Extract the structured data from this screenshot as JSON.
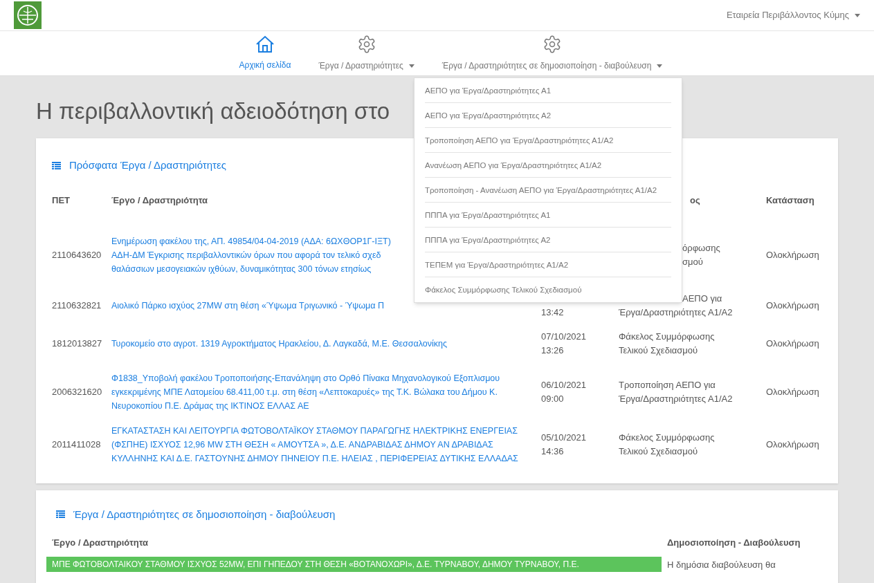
{
  "topbar": {
    "user_menu": "Εταιρεία Περιβάλλοντος Κύμης"
  },
  "nav": [
    {
      "label": "Αρχική σελίδα",
      "selected": true,
      "dropdown": false
    },
    {
      "label": "Έργα / Δραστηριότητες",
      "selected": false,
      "dropdown": true
    },
    {
      "label": "Έργα / Δραστηριότητες σε δημοσιοποίηση - διαβούλευση",
      "selected": false,
      "dropdown": true
    }
  ],
  "open_menu": [
    "ΑΕΠΟ για Έργα/Δραστηριότητες Α1",
    "ΑΕΠΟ για Έργα/Δραστηριότητες Α2",
    "Τροποποίηση ΑΕΠΟ για Έργα/Δραστηριότητες Α1/Α2",
    "Ανανέωση ΑΕΠΟ για Έργα/Δραστηριότητες Α1/Α2",
    "Τροποποίηση - Ανανέωση ΑΕΠΟ για Έργα/Δραστηριότητες Α1/Α2",
    "ΠΠΠΑ για Έργα/Δραστηριότητες Α1",
    "ΠΠΠΑ για Έργα/Δραστηριότητες Α2",
    "ΤΕΠΕΜ για Έργα/Δραστηριότητες Α1/Α2",
    "Φάκελος Συμμόρφωσης Τελικού Σχεδιασμού"
  ],
  "page_title": "Η περιβαλλοντική αδειοδότηση στο",
  "recent": {
    "title": "Πρόσφατα Έργα / Δραστηριότητες",
    "columns": [
      "ΠΕΤ",
      "Έργο / Δραστηριότητα",
      "ος",
      "Κατάσταση"
    ],
    "rows": [
      {
        "pet": "2110643620",
        "title": [
          "Ενημέρωση φακέλου της, ΑΠ. 49854/04-04-2019 (ΑΔΑ: 6ΩΧΘΟΡ1Γ-ΙΞΤ)",
          "ΑΔΗ-ΔΜ Έγκρισης περιβαλλοντικών όρων που αφορά τον τελικό σχεδ",
          "θαλάσσιων μεσογειακών ιχθύων, δυναμικότητας 300 τόνων ετησίως"
        ],
        "type": [
          "όρφωσης",
          "σμού"
        ],
        "status": "Ολοκλήρωση"
      },
      {
        "pet": "2110632821",
        "title": [
          "Αιολικό Πάρκο ισχύος 27MW στη θέση «Ύψωμα Τριγωνικό - Ύψωμα Π"
        ],
        "date": [
          "13:42"
        ],
        "type": [
          "ΑΕΠΟ για",
          "Έργα/Δραστηριότητες Α1/Α2"
        ],
        "status": "Ολοκλήρωση"
      },
      {
        "pet": "1812013827",
        "title": [
          "Τυροκομείο στο αγροτ. 1319 Αγροκτήματος Ηρακλείου, Δ. Λαγκαδά, Μ.Ε. Θεσσαλονίκης"
        ],
        "date": [
          "07/10/2021",
          "13:26"
        ],
        "type": [
          "Φάκελος Συμμόρφωσης",
          "Τελικού Σχεδιασμού"
        ],
        "status": "Ολοκλήρωση"
      },
      {
        "pet": "2006321620",
        "title": [
          "Φ1838_Υποβολή φακέλου Τροποποιήσης-Επανάληψη στο Ορθό Πίνακα Μηχανολογικού Εξοπλισμου εγκεκριμένης ΜΠΕ Λατομείου 68.411,00 τ.μ. στη θέση «Λεπτοκαρυές» της Τ.Κ. Βώλακα του Δήμου Κ. Νευροκοπίου Π.Ε. Δράμας της ΙΚΤΙΝΟΣ ΕΛΛΑΣ ΑΕ"
        ],
        "date": [
          "06/10/2021",
          "09:00"
        ],
        "type": [
          "Τροποποίηση ΑΕΠΟ για",
          "Έργα/Δραστηριότητες Α1/Α2"
        ],
        "status": "Ολοκλήρωση"
      },
      {
        "pet": "2011411028",
        "title": [
          "ΕΓΚΑΤΑΣΤΑΣΗ ΚΑΙ ΛΕΙΤΟΥΡΓΙΑ ΦΩΤΟΒΟΛΤΑΪΚΟΥ ΣΤΑΘΜΟΥ ΠΑΡΑΓΩΓΗΣ ΗΛΕΚΤΡΙΚΗΣ ΕΝΕΡΓΕΙΑΣ (ΦΣΠΗΕ) ΙΣΧΥΟΣ 12,96 MW ΣΤΗ ΘΕΣΗ « ΑΜΟΥΤΣΑ », Δ.Ε. ΑΝΔΡΑΒΙΔΑΣ ΔΗΜΟΥ ΑΝ ΔΡΑΒΙΔΑΣ ΚΥΛΛΗΝΗΣ ΚΑΙ Δ.Ε. ΓΑΣΤΟΥΝΗΣ ΔΗΜΟΥ ΠΗΝΕΙΟΥ Π.Ε. ΗΛΕΙΑΣ , ΠΕΡΙΦΕΡΕΙΑΣ ΔΥΤΙΚΗΣ ΕΛΛΑΔΑΣ"
        ],
        "date": [
          "05/10/2021",
          "14:36"
        ],
        "type": [
          "Φάκελος Συμμόρφωσης",
          "Τελικού Σχεδιασμού"
        ],
        "status": "Ολοκλήρωση"
      }
    ]
  },
  "consultation": {
    "title": "Έργα / Δραστηριότητες σε δημοσιοποίηση - διαβούλευση",
    "columns": [
      "Έργο / Δραστηριότητα",
      "Δημοσιοποίηση - Διαβούλευση"
    ],
    "rows": [
      {
        "title": "ΜΠΕ ΦΩΤΟΒΟΛΤΑΙΚΟΥ ΣΤΑΘΜΟΥ ΙΣΧΥΟΣ 52MW, ΕΠΙ ΓΗΠΕΔΟΥ ΣΤΗ ΘΕΣΗ «ΒΟΤΑΝΟΧΩΡΙ», Δ.Ε. ΤΥΡΝΑΒΟΥ, ΔΗΜΟΥ ΤΥΡΝΑΒΟΥ, Π.Ε.",
        "color": "#5cc45c",
        "status": "Η δημόσια διαβούλευση θα"
      }
    ]
  }
}
